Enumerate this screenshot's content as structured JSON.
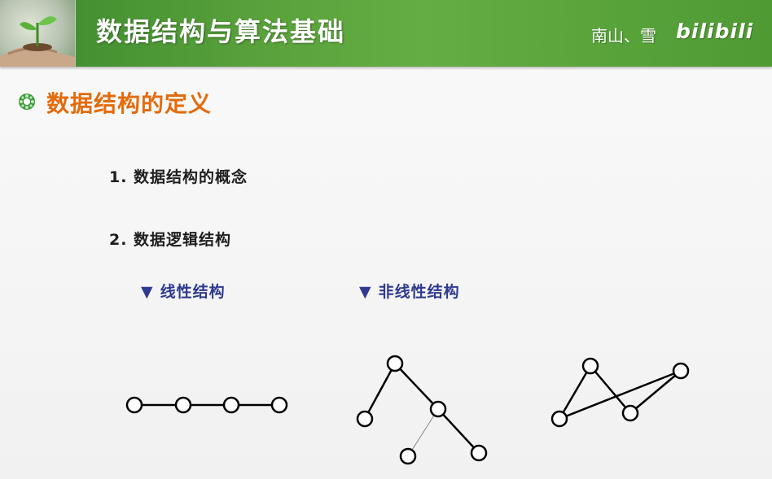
{
  "header": {
    "title": "数据结构与算法基础",
    "author": "南山、雪",
    "logo": "bilibili"
  },
  "section": {
    "title": "数据结构的定义",
    "bullet_icon": "green-flower-bullet-icon"
  },
  "items": [
    {
      "label": "1. 数据结构的概念"
    },
    {
      "label": "2. 数据逻辑结构"
    }
  ],
  "subitems": [
    {
      "label": "线性结构"
    },
    {
      "label": "非线性结构"
    }
  ],
  "colors": {
    "header_green": "#5aa23c",
    "section_orange": "#e46b0c",
    "sub_blue": "#2f3a8f"
  }
}
